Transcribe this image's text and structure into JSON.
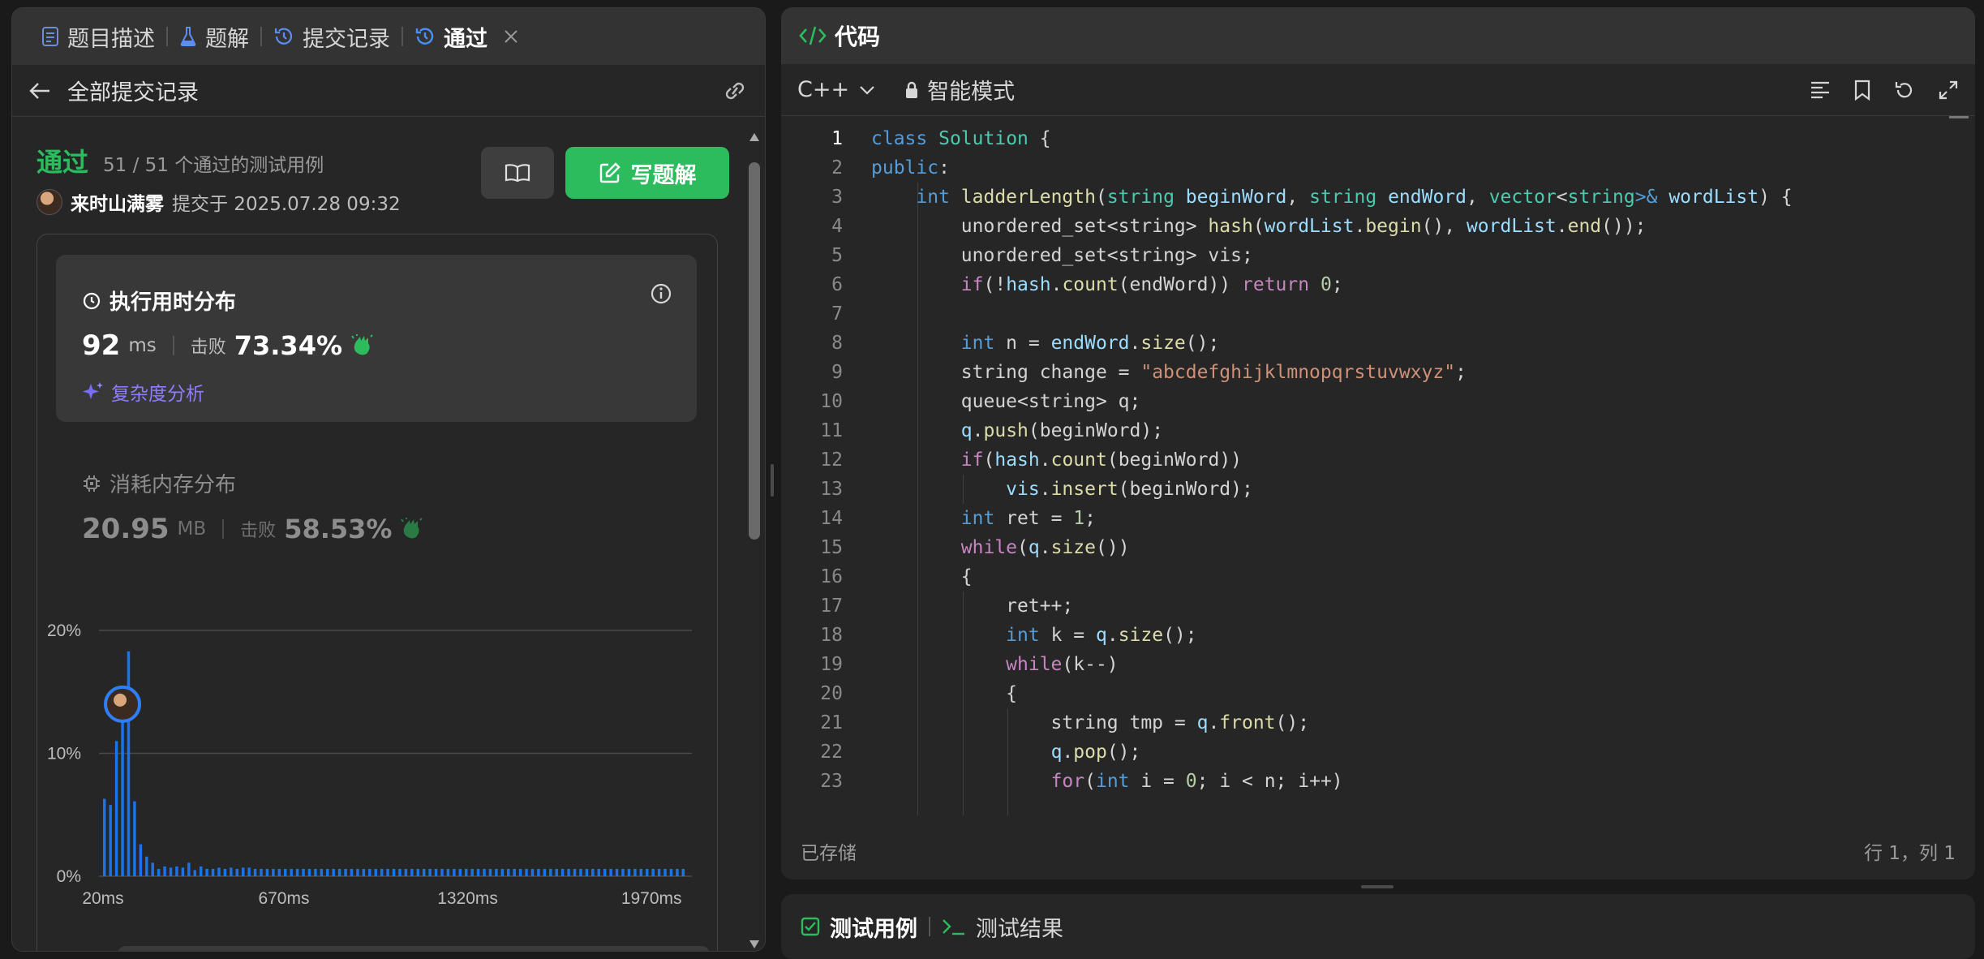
{
  "left_tabs": [
    {
      "label": "题目描述"
    },
    {
      "label": "题解"
    },
    {
      "label": "提交记录"
    },
    {
      "label": "通过"
    }
  ],
  "subheader": {
    "label": "全部提交记录"
  },
  "submission": {
    "status": "通过",
    "cases": "51 / 51 个通过的测试用例",
    "author": "来时山满雾",
    "submit_time": "提交于 2025.07.28 09:32",
    "write_solution": "写题解"
  },
  "runtime": {
    "title": "执行用时分布",
    "value": "92",
    "unit": "ms",
    "beat_label": "击败",
    "beat_value": "73.34%",
    "complexity": "复杂度分析"
  },
  "memory": {
    "title": "消耗内存分布",
    "value": "20.95",
    "unit": "MB",
    "beat_label": "击败",
    "beat_value": "58.53%"
  },
  "chart_data": {
    "type": "bar",
    "y_ticks": [
      "20%",
      "10%",
      "0%"
    ],
    "x_ticks": [
      "20ms",
      "670ms",
      "1320ms",
      "1970ms"
    ],
    "ylim": [
      0,
      20
    ],
    "values": [
      6.3,
      5.8,
      11.0,
      14.0,
      18.3,
      6.1,
      2.6,
      1.6,
      1.1,
      0.6,
      0.8,
      0.7,
      0.8,
      0.7,
      1.1,
      0.5,
      0.8,
      0.6,
      0.6,
      0.7,
      0.6,
      0.7,
      0.6,
      0.7,
      0.7,
      0.6,
      0.6,
      0.6,
      0.6,
      0.6,
      0.6,
      0.6,
      0.6,
      0.6,
      0.6,
      0.6,
      0.6,
      0.6,
      0.6,
      0.6,
      0.6,
      0.6,
      0.6,
      0.6,
      0.6,
      0.6,
      0.6,
      0.6,
      0.6,
      0.6,
      0.6,
      0.6,
      0.6,
      0.6,
      0.6,
      0.6,
      0.6,
      0.6,
      0.6,
      0.6,
      0.6,
      0.6,
      0.6,
      0.6,
      0.6,
      0.6,
      0.6,
      0.6,
      0.6,
      0.6,
      0.6,
      0.6,
      0.6,
      0.6,
      0.6,
      0.6,
      0.6,
      0.6,
      0.6,
      0.6,
      0.6,
      0.6,
      0.6,
      0.6,
      0.6,
      0.6,
      0.6,
      0.6,
      0.6,
      0.6,
      0.6,
      0.6,
      0.6,
      0.6,
      0.6,
      0.6,
      0.6
    ],
    "bar_color": "#1a73e8",
    "marker_value": 14.0
  },
  "editor": {
    "title": "代码",
    "language": "C++",
    "mode": "智能模式",
    "saved": "已存储",
    "cursor": "行 1，列 1",
    "lines": [
      [
        [
          "kw",
          "class"
        ],
        [
          "",
          "​ "
        ],
        [
          "ty",
          "Solution"
        ],
        [
          "",
          " {"
        ]
      ],
      [
        [
          "kw",
          "public"
        ],
        [
          "",
          ":"
        ]
      ],
      [
        [
          "",
          "    "
        ],
        [
          "kw",
          "int"
        ],
        [
          "",
          " "
        ],
        [
          "fn",
          "ladderLength"
        ],
        [
          "",
          "("
        ],
        [
          "ty",
          "string"
        ],
        [
          "",
          " "
        ],
        [
          "var",
          "beginWord"
        ],
        [
          "",
          ", "
        ],
        [
          "ty",
          "string"
        ],
        [
          "",
          " "
        ],
        [
          "var",
          "endWord"
        ],
        [
          "",
          ", "
        ],
        [
          "ty",
          "vector"
        ],
        [
          "",
          "<"
        ],
        [
          "ty",
          "string"
        ],
        [
          "kw",
          ">&"
        ],
        [
          "",
          " "
        ],
        [
          "var",
          "wordList"
        ],
        [
          "",
          ") {"
        ]
      ],
      [
        [
          "",
          "        unordered_set<string> "
        ],
        [
          "fn",
          "hash"
        ],
        [
          "",
          "("
        ],
        [
          "var",
          "wordList"
        ],
        [
          "",
          "."
        ],
        [
          "fn",
          "begin"
        ],
        [
          "",
          "(), "
        ],
        [
          "var",
          "wordList"
        ],
        [
          "",
          "."
        ],
        [
          "fn",
          "end"
        ],
        [
          "",
          "());"
        ]
      ],
      [
        [
          "",
          "        unordered_set<string> vis;"
        ]
      ],
      [
        [
          "",
          "        "
        ],
        [
          "ctl",
          "if"
        ],
        [
          "",
          "(!"
        ],
        [
          "var",
          "hash"
        ],
        [
          "",
          "."
        ],
        [
          "fn",
          "count"
        ],
        [
          "",
          "(endWord)) "
        ],
        [
          "ctl",
          "return"
        ],
        [
          "",
          " "
        ],
        [
          "num",
          "0"
        ],
        [
          "",
          ";"
        ]
      ],
      [
        [
          "",
          ""
        ]
      ],
      [
        [
          "",
          "        "
        ],
        [
          "kw",
          "int"
        ],
        [
          "",
          " n = "
        ],
        [
          "var",
          "endWord"
        ],
        [
          "",
          "."
        ],
        [
          "fn",
          "size"
        ],
        [
          "",
          "();"
        ]
      ],
      [
        [
          "",
          "        string change = "
        ],
        [
          "str",
          "\"abcdefghijklmnopqrstuvwxyz\""
        ],
        [
          "",
          ";"
        ]
      ],
      [
        [
          "",
          "        queue<string> q;"
        ]
      ],
      [
        [
          "",
          "        "
        ],
        [
          "var",
          "q"
        ],
        [
          "",
          "."
        ],
        [
          "fn",
          "push"
        ],
        [
          "",
          "(beginWord);"
        ]
      ],
      [
        [
          "",
          "        "
        ],
        [
          "ctl",
          "if"
        ],
        [
          "",
          "("
        ],
        [
          "var",
          "hash"
        ],
        [
          "",
          "."
        ],
        [
          "fn",
          "count"
        ],
        [
          "",
          "(beginWord))"
        ]
      ],
      [
        [
          "",
          "            "
        ],
        [
          "var",
          "vis"
        ],
        [
          "",
          "."
        ],
        [
          "fn",
          "insert"
        ],
        [
          "",
          "(beginWord);"
        ]
      ],
      [
        [
          "",
          "        "
        ],
        [
          "kw",
          "int"
        ],
        [
          "",
          " ret = "
        ],
        [
          "num",
          "1"
        ],
        [
          "",
          ";"
        ]
      ],
      [
        [
          "",
          "        "
        ],
        [
          "ctl",
          "while"
        ],
        [
          "",
          "("
        ],
        [
          "var",
          "q"
        ],
        [
          "",
          "."
        ],
        [
          "fn",
          "size"
        ],
        [
          "",
          "())"
        ]
      ],
      [
        [
          "",
          "        {"
        ]
      ],
      [
        [
          "",
          "            ret++;"
        ]
      ],
      [
        [
          "",
          "            "
        ],
        [
          "kw",
          "int"
        ],
        [
          "",
          " k = "
        ],
        [
          "var",
          "q"
        ],
        [
          "",
          "."
        ],
        [
          "fn",
          "size"
        ],
        [
          "",
          "();"
        ]
      ],
      [
        [
          "",
          "            "
        ],
        [
          "ctl",
          "while"
        ],
        [
          "",
          "(k--)"
        ]
      ],
      [
        [
          "",
          "            {"
        ]
      ],
      [
        [
          "",
          "                string tmp = "
        ],
        [
          "var",
          "q"
        ],
        [
          "",
          "."
        ],
        [
          "fn",
          "front"
        ],
        [
          "",
          "();"
        ]
      ],
      [
        [
          "",
          "                "
        ],
        [
          "var",
          "q"
        ],
        [
          "",
          "."
        ],
        [
          "fn",
          "pop"
        ],
        [
          "",
          "();"
        ]
      ],
      [
        [
          "",
          "                "
        ],
        [
          "ctl",
          "for"
        ],
        [
          "",
          "("
        ],
        [
          "kw",
          "int"
        ],
        [
          "",
          " i = "
        ],
        [
          "num",
          "0"
        ],
        [
          "",
          "; i < n; i++)"
        ]
      ]
    ]
  },
  "bottom_tabs": {
    "testcase": "测试用例",
    "result": "测试结果"
  }
}
